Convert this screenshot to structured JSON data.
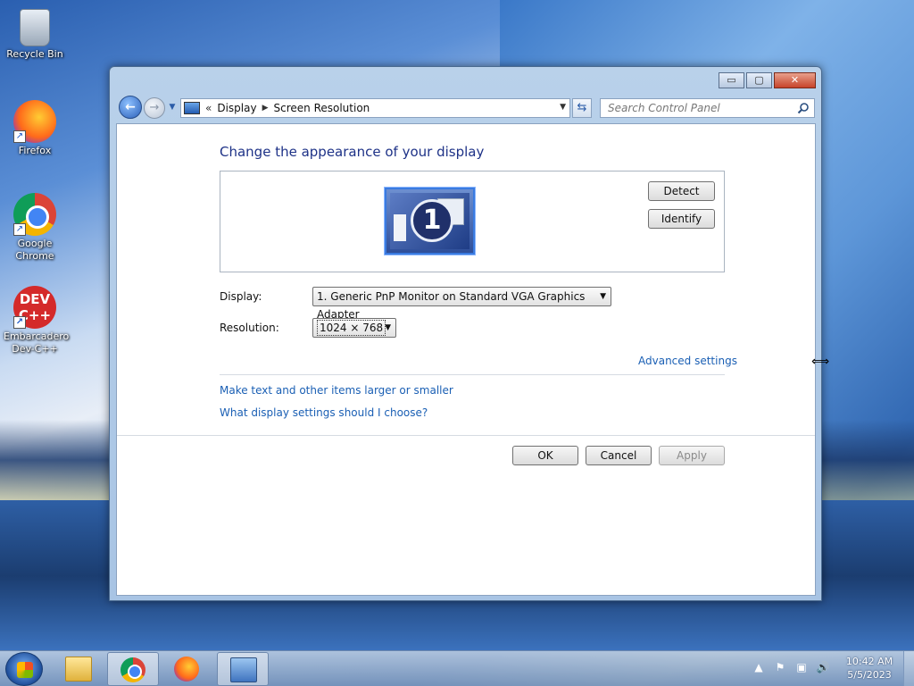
{
  "desktop": {
    "icons": [
      {
        "label": "Recycle Bin"
      },
      {
        "label": "Firefox"
      },
      {
        "label": "Google Chrome"
      },
      {
        "label": "Embarcadero Dev-C++"
      }
    ],
    "devcpp_badge": "DEV C++"
  },
  "window": {
    "controls": {
      "minimize": "▭",
      "maximize": "▢",
      "close": "✕"
    },
    "address": {
      "overflow": "«",
      "crumbs": [
        "Display",
        "Screen Resolution"
      ]
    },
    "search_placeholder": "Search Control Panel",
    "heading": "Change the appearance of your display",
    "monitor_number": "1",
    "detect_label": "Detect",
    "identify_label": "Identify",
    "display_label": "Display:",
    "display_value": "1. Generic PnP Monitor on Standard VGA Graphics Adapter",
    "resolution_label": "Resolution:",
    "resolution_value": "1024 × 768",
    "advanced_link": "Advanced settings",
    "text_size_link": "Make text and other items larger or smaller",
    "help_link": "What display settings should I choose?",
    "ok_label": "OK",
    "cancel_label": "Cancel",
    "apply_label": "Apply"
  },
  "taskbar": {
    "items": [
      "Windows Explorer",
      "Google Chrome",
      "Firefox",
      "Screen Resolution"
    ],
    "clock_time": "10:42 AM",
    "clock_date": "5/5/2023"
  }
}
